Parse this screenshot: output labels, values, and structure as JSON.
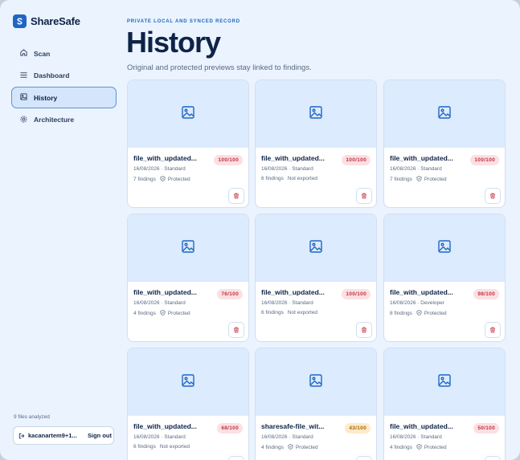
{
  "brand": {
    "name": "ShareSafe"
  },
  "sidebar": {
    "items": [
      {
        "label": "Scan",
        "icon": "home-icon",
        "active": false
      },
      {
        "label": "Dashboard",
        "icon": "list-icon",
        "active": false
      },
      {
        "label": "History",
        "icon": "image-icon",
        "active": true
      },
      {
        "label": "Architecture",
        "icon": "gear-icon",
        "active": false
      }
    ],
    "files_analyzed": "9 files analyzed",
    "user_email": "kacanartem9+1...",
    "sign_out_label": "Sign out"
  },
  "header": {
    "eyebrow": "PRIVATE LOCAL AND SYNCED RECORD",
    "title": "History",
    "subtitle": "Original and protected previews stay linked to findings."
  },
  "colors": {
    "accent": "#1f66c4",
    "score_high_bg": "#fbe0e3",
    "score_high_fg": "#c53040",
    "score_mid_bg": "#fdebc8",
    "score_mid_fg": "#a86408"
  },
  "cards": [
    {
      "name": "file_with_updated...",
      "score": "100/100",
      "score_level": "red",
      "meta": "16/08/2026 · Standard",
      "findings": "7 findings",
      "status": "Protected",
      "protected": true
    },
    {
      "name": "file_with_updated...",
      "score": "100/100",
      "score_level": "red",
      "meta": "16/08/2026 · Standard",
      "findings": "6 findings",
      "status": "Not exported",
      "protected": false
    },
    {
      "name": "file_with_updated...",
      "score": "100/100",
      "score_level": "red",
      "meta": "16/08/2026 · Standard",
      "findings": "7 findings",
      "status": "Protected",
      "protected": true
    },
    {
      "name": "file_with_updated...",
      "score": "76/100",
      "score_level": "red",
      "meta": "16/08/2026 · Standard",
      "findings": "4 findings",
      "status": "Protected",
      "protected": true
    },
    {
      "name": "file_with_updated...",
      "score": "100/100",
      "score_level": "red",
      "meta": "16/08/2026 · Standard",
      "findings": "6 findings",
      "status": "Not exported",
      "protected": false
    },
    {
      "name": "file_with_updated...",
      "score": "98/100",
      "score_level": "red",
      "meta": "16/08/2026 · Developer",
      "findings": "8 findings",
      "status": "Protected",
      "protected": true
    },
    {
      "name": "file_with_updated...",
      "score": "68/100",
      "score_level": "red",
      "meta": "16/08/2026 · Standard",
      "findings": "6 findings",
      "status": "Not exported",
      "protected": false
    },
    {
      "name": "sharesafe-file_wit...",
      "score": "43/100",
      "score_level": "amber",
      "meta": "16/08/2026 · Standard",
      "findings": "4 findings",
      "status": "Protected",
      "protected": true
    },
    {
      "name": "file_with_updated...",
      "score": "50/100",
      "score_level": "red",
      "meta": "16/08/2026 · Standard",
      "findings": "4 findings",
      "status": "Protected",
      "protected": true
    }
  ]
}
